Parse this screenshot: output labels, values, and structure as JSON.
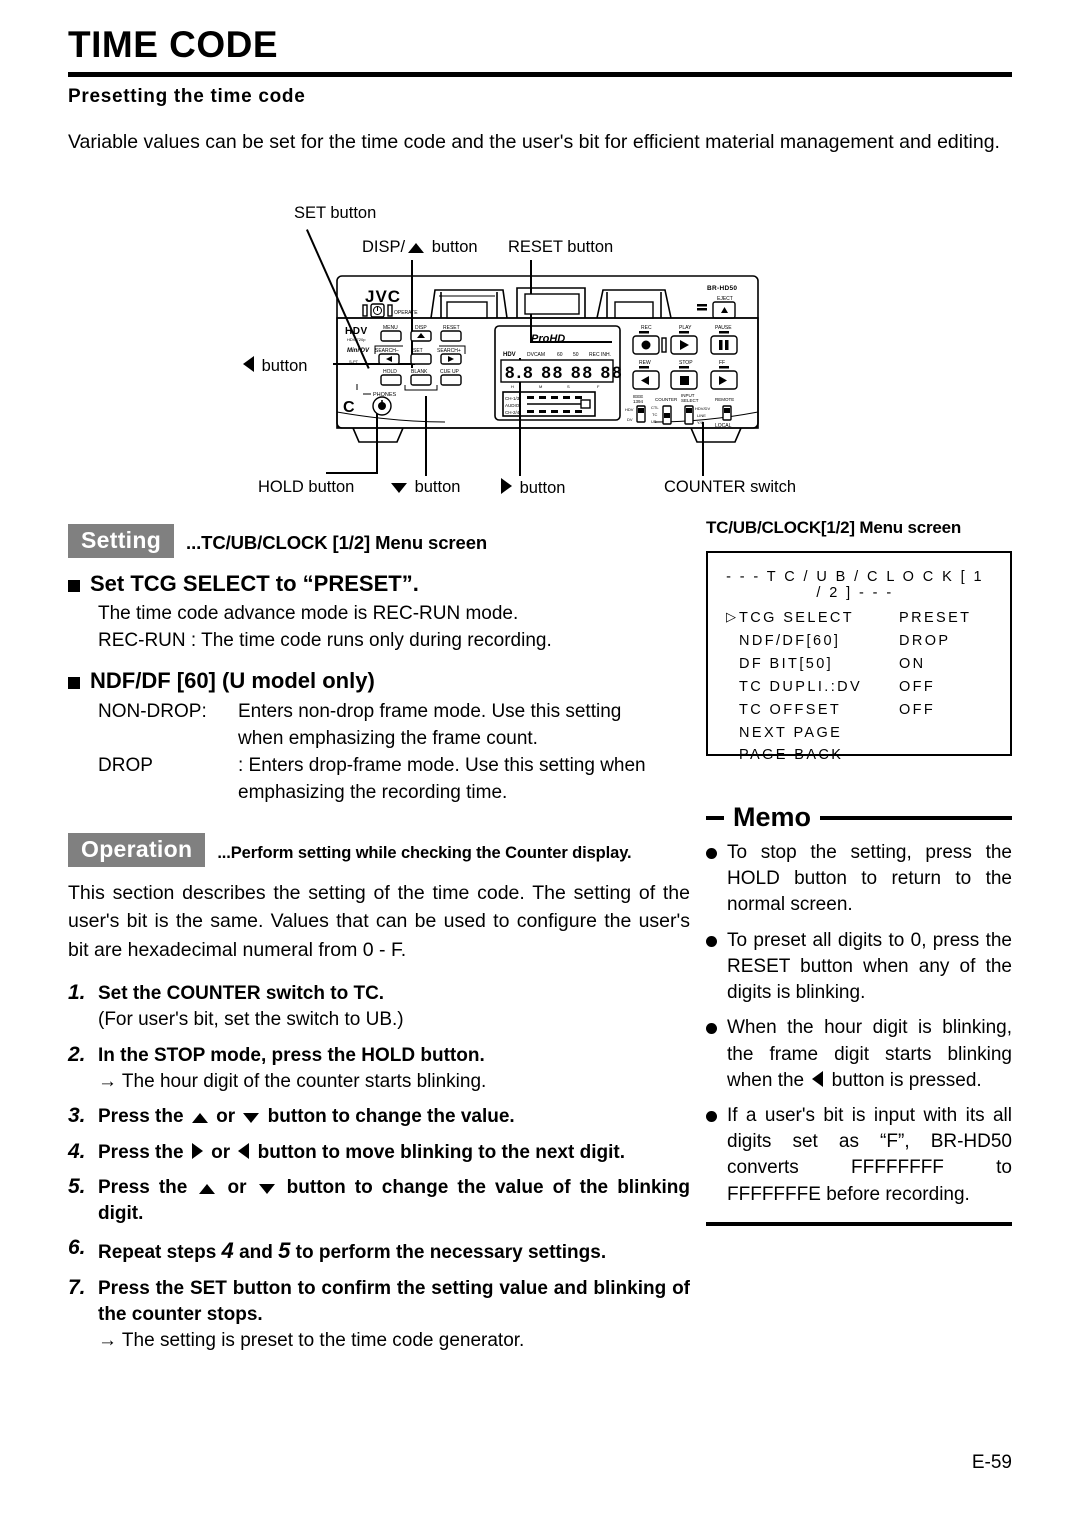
{
  "header": {
    "title": "TIME CODE",
    "subtitle": "Presetting the time code",
    "intro": "Variable values can be set for the time code and the user's bit for efficient material management and editing."
  },
  "diagram": {
    "callouts": {
      "set_button": "SET button",
      "disp_button_pre": "DISP/",
      "disp_button_post": " button",
      "reset_button": "RESET button",
      "left_button": " button",
      "hold_button": "HOLD button",
      "down_button": " button",
      "right_button": " button",
      "counter_switch": "COUNTER switch"
    },
    "device": {
      "brand": "JVC",
      "model": "BR-HD50",
      "logo": "ProHD",
      "operate": "OPERATE",
      "eject": "EJECT",
      "hdv": "HDV",
      "hdv_sub": "HDV 720p",
      "minidv": "Mini DV",
      "menu": "MENU",
      "disp": "DISP",
      "reset": "RESET",
      "search_minus": "SEARCH–",
      "set": "SET",
      "search_plus": "SEARCH+",
      "hold": "HOLD",
      "blank": "BLANK",
      "cue_up": "CUE UP",
      "phones": "PHONES",
      "counter_hdv": "HDV",
      "dvcam": "DVCAM",
      "sixty": "60",
      "fifty": "50",
      "rec_inh": "REC INH.",
      "ch13": "CH-1/3",
      "audio": "AUDIO",
      "ch24": "CH-2/4",
      "rec": "REC",
      "play": "PLAY",
      "pause": "PAUSE",
      "rew": "REW",
      "stop": "STOP",
      "ff": "FF",
      "ieee": "IEEE",
      "ieee2": "1394",
      "counter": "COUNTER",
      "input": "INPUT",
      "select": "SELECT",
      "remote": "REMOTE",
      "sw_hdv": "HDV",
      "sw_dv": "DV",
      "sw_ctl": "CTL",
      "sw_tc": "TC",
      "sw_ub": "UB",
      "sw_hdvdv": "HDV/DV",
      "sw_line": "LINE",
      "sw_yc": "Y/C",
      "sw_local": "LOCAL",
      "counter_digits": "88 88 88 88",
      "counter_h": "H",
      "counter_m": "M",
      "counter_s": "S",
      "counter_f": "F"
    }
  },
  "setting": {
    "tag": "Setting",
    "note": "...TC/UB/CLOCK [1/2] Menu screen",
    "bullet1_title": "Set TCG SELECT to “PRESET”.",
    "bullet1_line1": "The time code advance mode is REC-RUN mode.",
    "bullet1_line2": "REC-RUN : The time code runs only during recording.",
    "bullet2_title": "NDF/DF [60] (U model only)",
    "defs": [
      {
        "key": "NON-DROP:",
        "value": "Enters non-drop frame mode. Use this setting",
        "cont": "when emphasizing the frame count."
      },
      {
        "key": "DROP",
        "value": ": Enters drop-frame mode. Use this setting when",
        "cont": "emphasizing the recording time."
      }
    ]
  },
  "operation": {
    "tag": "Operation",
    "note": "...Perform setting while checking the Counter display.",
    "intro": "This section describes the setting of the time code. The setting of the user's bit is the same. Values that can be used to configure the user's bit are hexadecimal numeral from 0 - F.",
    "steps": [
      {
        "num": "1.",
        "text": "Set the COUNTER switch to TC.",
        "sub": "(For user's bit, set the switch to UB.)"
      },
      {
        "num": "2.",
        "text": "In the STOP mode, press the HOLD button.",
        "sub": "→ The hour digit of the counter starts blinking."
      },
      {
        "num": "3.",
        "text_a": "Press the ",
        "text_b": " or ",
        "text_c": " button to change the value.",
        "sub": ""
      },
      {
        "num": "4.",
        "text_a": "Press the ",
        "text_b": " or ",
        "text_c": " button to move blinking to the next digit.",
        "sub": ""
      },
      {
        "num": "5.",
        "text_a": "Press the ",
        "text_b": " or ",
        "text_c": " button to change the value of the blinking digit.",
        "sub": ""
      },
      {
        "num": "6.",
        "text_a": "Repeat steps ",
        "big1": "4",
        "text_b": " and ",
        "big2": "5",
        "text_c": " to perform the necessary settings.",
        "sub": ""
      },
      {
        "num": "7.",
        "text": "Press the SET button to confirm the setting value and blinking of the counter stops.",
        "sub": "→ The setting is preset to the time code generator."
      }
    ]
  },
  "menu_screen": {
    "caption": "TC/UB/CLOCK[1/2] Menu screen",
    "title": "- - - T C / U B / C L O C K [ 1 / 2 ] - - -",
    "rows": [
      {
        "cursor": "▷",
        "name": "TCG  SELECT",
        "value": "PRESET"
      },
      {
        "cursor": "",
        "name": "NDF/DF[60]",
        "value": "DROP"
      },
      {
        "cursor": "",
        "name": "DF  BIT[50]",
        "value": "ON"
      },
      {
        "cursor": "",
        "name": "TC  DUPLI.:DV",
        "value": "OFF"
      },
      {
        "cursor": "",
        "name": "TC  OFFSET",
        "value": "OFF"
      },
      {
        "cursor": "",
        "name": "NEXT  PAGE",
        "value": ""
      },
      {
        "cursor": "",
        "name": "PAGE  BACK",
        "value": ""
      }
    ]
  },
  "memo": {
    "title": "Memo",
    "items": [
      {
        "text": "To stop the setting, press the HOLD button to return to the normal screen."
      },
      {
        "text": "To preset all digits to 0, press the RESET button when any of the digits is blinking."
      },
      {
        "a": "When the hour digit is blinking, the frame digit starts blinking when the ",
        "b": " button is pressed."
      },
      {
        "text": "If a user's bit is input with its all digits set as “F”, BR-HD50 converts  FFFFFFFF  to FFFFFFFE before recording."
      }
    ]
  },
  "footer": {
    "page": "E-59"
  },
  "colors": {
    "tag_gray": "#808080",
    "ink": "#000000",
    "paper": "#ffffff"
  }
}
